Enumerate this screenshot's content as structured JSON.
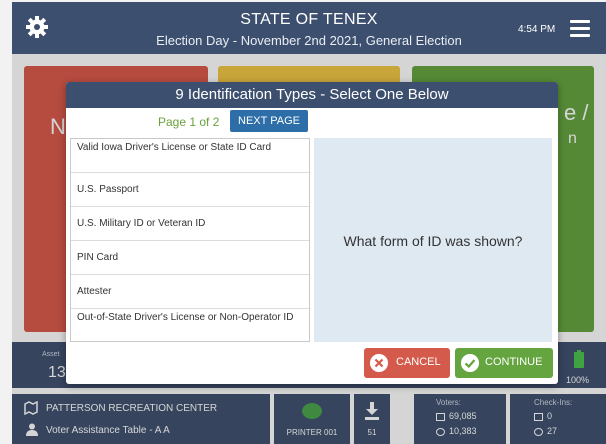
{
  "header": {
    "title": "STATE OF TENEX",
    "subtitle": "Election Day - November 2nd 2021, General Election",
    "time": "4:54 PM",
    "icons": [
      "gear-icon",
      "hamburger-menu-icon"
    ]
  },
  "tiles": {
    "red_text": "N",
    "green_text": "e /",
    "green_text2": "n"
  },
  "status_bar": {
    "asset_label": "Asset",
    "asset_value": "13",
    "battery": "100%"
  },
  "footer": {
    "location_name": "PATTERSON RECREATION CENTER",
    "table_name": "Voter Assistance Table - A A",
    "printer_label": "PRINTER 001",
    "download_count": "51",
    "voters_label": "Voters:",
    "voters_total": "69,085",
    "voters_checked": "10,383",
    "checkins_label": "Check-Ins:",
    "checkins_box": "0",
    "checkins_person": "27"
  },
  "modal": {
    "title": "9 Identification Types - Select One Below",
    "page_indicator": "Page 1 of 2",
    "next_page_label": "NEXT PAGE",
    "id_types": [
      "Valid Iowa Driver's License or State ID Card",
      "U.S. Passport",
      "U.S. Military ID or Veteran ID",
      "PIN Card",
      "Attester",
      "Out-of-State Driver's License or Non-Operator ID"
    ],
    "question": "What form of ID was shown?",
    "cancel_label": "CANCEL",
    "continue_label": "CONTINUE"
  },
  "colors": {
    "navy": "#3d4f6e",
    "red": "#d9574a",
    "yellow": "#efc642",
    "green": "#64a33e",
    "blue_button": "#2d6ea8",
    "panel_blue": "#dfe9f2"
  }
}
